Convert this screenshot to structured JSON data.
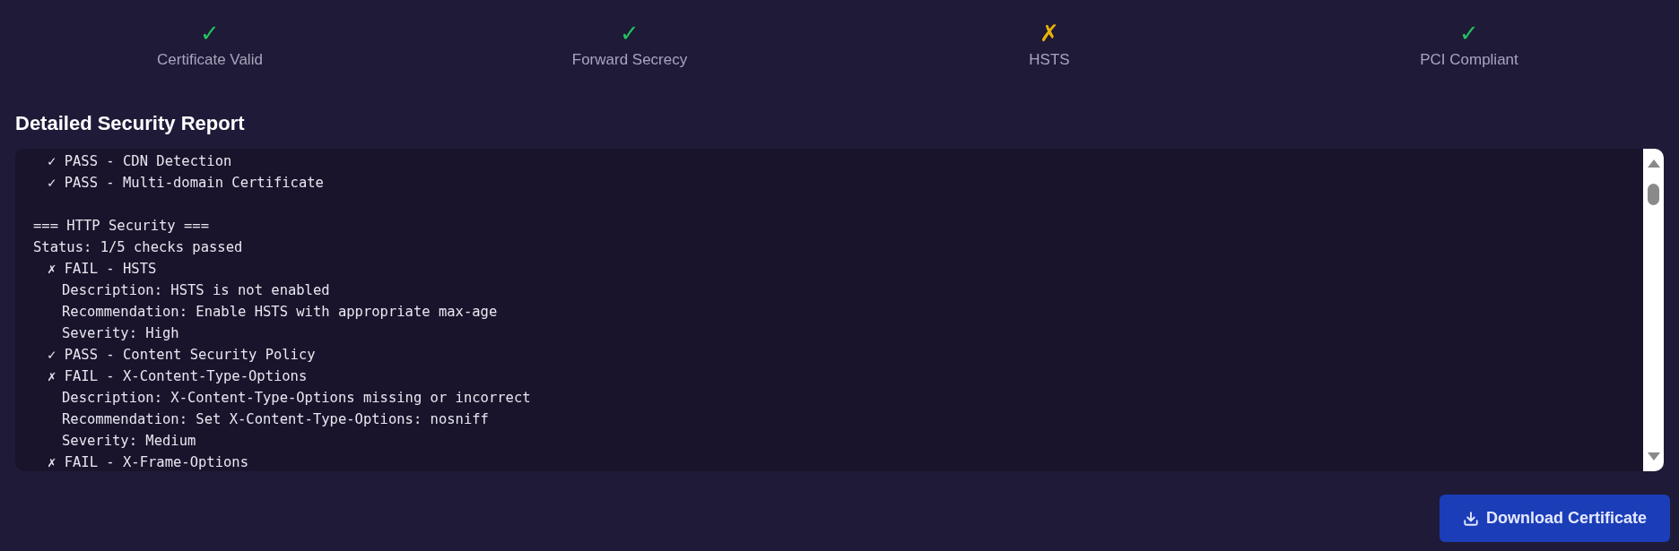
{
  "checks": [
    {
      "icon": "✓",
      "label": "Certificate Valid",
      "passed": true
    },
    {
      "icon": "✓",
      "label": "Forward Secrecy",
      "passed": true
    },
    {
      "icon": "✗",
      "label": "HSTS",
      "passed": false
    },
    {
      "icon": "✓",
      "label": "PCI Compliant",
      "passed": true
    }
  ],
  "report": {
    "title": "Detailed Security Report",
    "lines": [
      {
        "kind": "check",
        "text": "✓ PASS - CDN Detection"
      },
      {
        "kind": "check",
        "text": "✓ PASS - Multi-domain Certificate"
      },
      {
        "kind": "blank"
      },
      {
        "kind": "header",
        "text": "=== HTTP Security ==="
      },
      {
        "kind": "header",
        "text": "Status: 1/5 checks passed"
      },
      {
        "kind": "check",
        "text": "✗ FAIL - HSTS"
      },
      {
        "kind": "detail",
        "text": "Description: HSTS is not enabled"
      },
      {
        "kind": "detail",
        "text": "Recommendation: Enable HSTS with appropriate max-age"
      },
      {
        "kind": "detail",
        "text": "Severity: High"
      },
      {
        "kind": "check",
        "text": "✓ PASS - Content Security Policy"
      },
      {
        "kind": "check",
        "text": "✗ FAIL - X-Content-Type-Options"
      },
      {
        "kind": "detail",
        "text": "Description: X-Content-Type-Options missing or incorrect"
      },
      {
        "kind": "detail",
        "text": "Recommendation: Set X-Content-Type-Options: nosniff"
      },
      {
        "kind": "detail",
        "text": "Severity: Medium"
      },
      {
        "kind": "check",
        "text": "✗ FAIL - X-Frame-Options"
      }
    ]
  },
  "download_button": {
    "label": "Download Certificate"
  }
}
